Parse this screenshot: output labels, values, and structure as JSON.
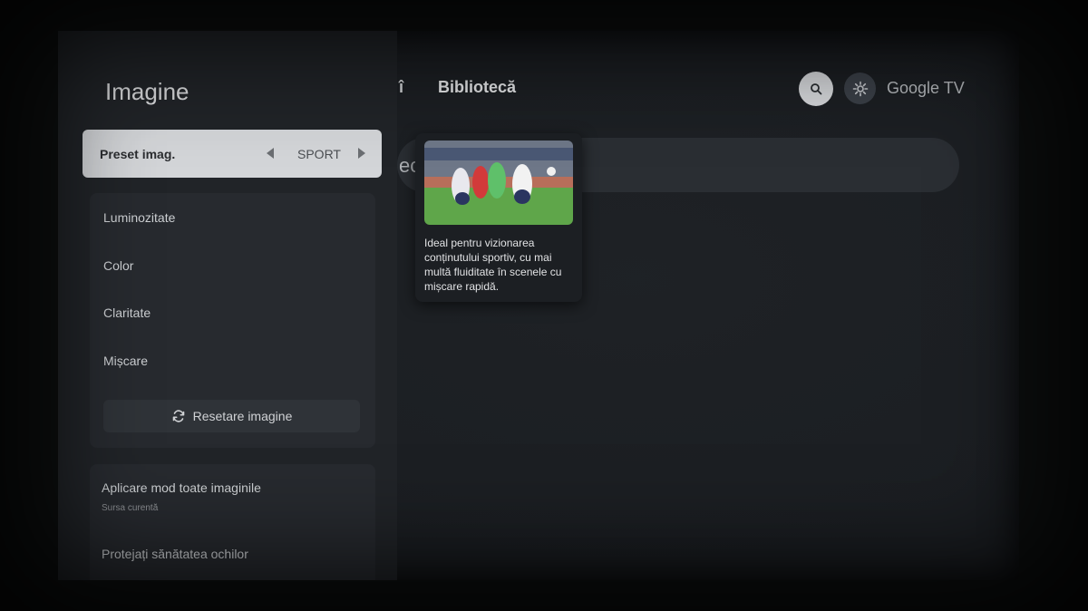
{
  "topbar": {
    "partial_tab": "î",
    "library_tab": "Bibliotecă",
    "search_icon": "search-icon",
    "settings_icon": "gear-icon",
    "brand": "Google TV",
    "background_partial_text": "ec"
  },
  "panel": {
    "title": "Imagine",
    "preset": {
      "label": "Preset imag.",
      "value": "SPORT"
    },
    "items": [
      {
        "label": "Luminozitate"
      },
      {
        "label": "Color"
      },
      {
        "label": "Claritate"
      },
      {
        "label": "Mișcare"
      }
    ],
    "reset": {
      "label": "Resetare imagine",
      "icon": "refresh-icon"
    },
    "apply": {
      "title": "Aplicare mod toate imaginile",
      "subtitle": "Sursa curentă"
    },
    "eye_health": "Protejați sănătatea ochilor"
  },
  "info_card": {
    "description": "Ideal pentru vizionarea conținutului sportiv, cu mai multă fluiditate în scenele cu mișcare rapidă."
  },
  "colors": {
    "selected_bg": "#d3d5d8",
    "panel_bg": "#212428",
    "screen_bg": "#1b1e22"
  }
}
